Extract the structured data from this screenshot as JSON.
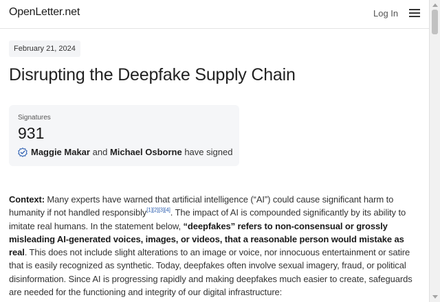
{
  "header": {
    "brand": "OpenLetter.net",
    "login_label": "Log In",
    "menu_icon": "hamburger-menu-icon"
  },
  "article": {
    "date": "February 21, 2024",
    "title": "Disrupting the Deepfake Supply Chain"
  },
  "signatures": {
    "label": "Signatures",
    "count": "931",
    "signer_1": "Maggie Makar",
    "connector": "and",
    "signer_2": "Michael Osborne",
    "suffix": "have signed",
    "icon": "verified-badge-icon"
  },
  "context": {
    "lead": "Context:",
    "text_1": " Many experts have warned that artificial intelligence (“AI”) could cause significant harm to humanity if not handled responsibly",
    "citations": [
      "[1]",
      "[2]",
      "[3]",
      "[4]"
    ],
    "text_2": ". The impact of AI is compounded significantly by its ability to imitate real humans. In the statement below, ",
    "bold_definition": "“deepfakes” refers to non-consensual or grossly misleading AI-generated voices, images, or videos, that a reasonable person would mistake as real",
    "text_3": ". This does not include slight alterations to an image or voice, nor innocuous entertainment or satire that is easily recognized as synthetic. Today, deepfakes often involve sexual imagery, fraud, or political disinformation. Since AI is progressing rapidly and making deepfakes much easier to create, safeguards are needed for the functioning and integrity of our digital infrastructure:"
  },
  "colors": {
    "accent": "#2a5db0",
    "card_background": "#f5f6f8",
    "date_background": "#f3f4f6"
  }
}
